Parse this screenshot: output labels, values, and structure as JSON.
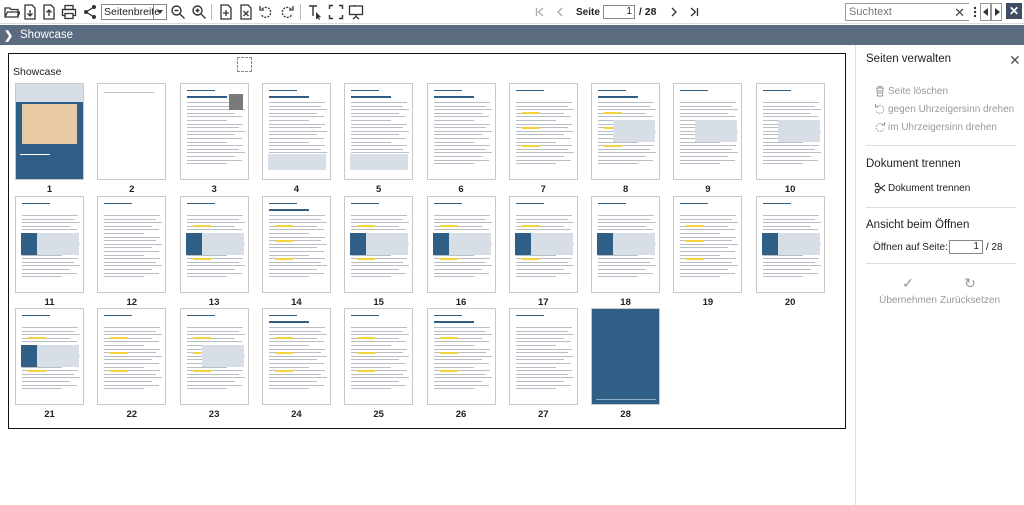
{
  "toolbar": {
    "icons": [
      "folder-open-icon",
      "export-icon",
      "save-icon",
      "print-icon",
      "share-icon",
      "zoom-out-icon",
      "zoom-in-icon",
      "add-page-icon",
      "delete-page-icon",
      "rotate-ccw-icon",
      "rotate-cw-icon",
      "text-select-icon",
      "fullscreen-icon",
      "presentation-icon"
    ],
    "zoom_value": "Seitenbreite",
    "page_label": "Seite",
    "page_current": "1",
    "page_total": "/ 28",
    "search_placeholder": "Suchtext"
  },
  "titlebar": {
    "title": "Showcase"
  },
  "main": {
    "section_title": "Showcase",
    "pages": [
      "1",
      "2",
      "3",
      "4",
      "5",
      "6",
      "7",
      "8",
      "9",
      "10",
      "11",
      "12",
      "13",
      "14",
      "15",
      "16",
      "17",
      "18",
      "19",
      "20",
      "21",
      "22",
      "23",
      "24",
      "25",
      "26",
      "27",
      "28"
    ]
  },
  "panel": {
    "title": "Seiten verwalten",
    "delete_page": "Seite löschen",
    "rotate_ccw": "gegen Uhrzeigersinn drehen",
    "rotate_cw": "im Uhrzeigersinn drehen",
    "split_section": "Dokument trennen",
    "split_button": "Dokument trennen",
    "open_section": "Ansicht beim Öffnen",
    "open_label": "Öffnen auf Seite:",
    "open_value": "1",
    "open_total": "/ 28",
    "apply": "Übernehmen",
    "reset": "Zurücksetzen"
  },
  "colors": {
    "titlebar": "#5b6b80",
    "accent_blue": "#2f5e87",
    "highlight": "#f4d33d"
  }
}
